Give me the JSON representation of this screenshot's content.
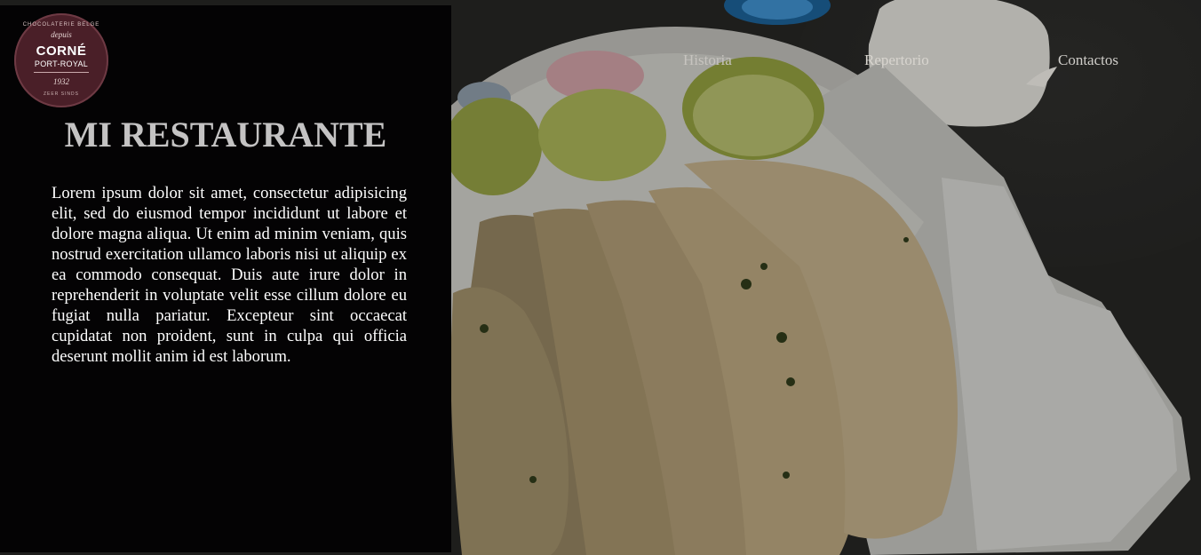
{
  "logo": {
    "ring_top": "CHOCOLATERIE BELGE",
    "depuis": "depuis",
    "brand": "CORNÉ",
    "sub": "PORT-ROYAL",
    "year": "1932",
    "ring_bottom": "ZEER SINDS"
  },
  "hero": {
    "title": "MI RESTAURANTE",
    "text": "Lorem ipsum dolor sit amet, consectetur adipisicing elit, sed do eiusmod tempor incididunt ut labore et dolore magna aliqua. Ut enim ad minim veniam, quis nostrud exercitation ullamco laboris nisi ut aliquip ex ea commodo consequat. Duis aute irure dolor in reprehenderit in voluptate velit esse cillum dolore eu fugiat nulla pariatur. Excepteur sint occaecat cupidatat non proident, sunt in culpa qui officia deserunt mollit anim id est laborum."
  },
  "nav": {
    "items": [
      {
        "label": "Historia"
      },
      {
        "label": "Repertorio"
      },
      {
        "label": "Contactos"
      }
    ]
  },
  "colors": {
    "panel_bg": "#040304",
    "title": "#c4c3c3",
    "logo_bg": "#4a1f28"
  }
}
